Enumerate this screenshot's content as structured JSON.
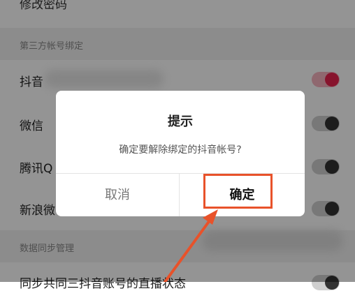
{
  "settings": {
    "top_item_label": "修改密码",
    "section_third_party": "第三方帐号绑定",
    "rows": [
      {
        "label": "抖音",
        "toggle_on": true
      },
      {
        "label": "微信",
        "toggle_on": false
      },
      {
        "label": "腾讯Q",
        "toggle_on": false
      },
      {
        "label": "新浪微",
        "toggle_on": false
      }
    ],
    "section_sync": "数据同步管理",
    "bottom_item_label": "同步共同三抖音账号的直播状态"
  },
  "dialog": {
    "title": "提示",
    "message": "确定要解除绑定的抖音帐号?",
    "cancel_label": "取消",
    "confirm_label": "确定"
  },
  "colors": {
    "accent": "#e8244f",
    "annotation": "#e8522a"
  },
  "icons": {
    "top_chevron": "chevron-right-icon"
  }
}
